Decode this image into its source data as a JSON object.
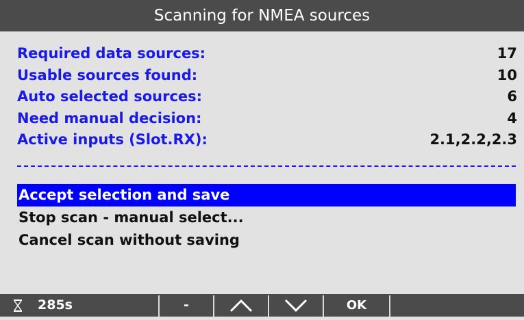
{
  "title": "Scanning for NMEA sources",
  "stats": [
    {
      "label": "Required data sources:",
      "value": "17"
    },
    {
      "label": "Usable sources found:",
      "value": "10"
    },
    {
      "label": "Auto selected sources:",
      "value": "6"
    },
    {
      "label": "Need manual decision:",
      "value": "4"
    },
    {
      "label": "Active inputs (Slot.RX):",
      "value": "2.1,2.2,2.3"
    }
  ],
  "menu": [
    {
      "label": "Accept selection and save",
      "selected": true
    },
    {
      "label": "Stop scan - manual select...",
      "selected": false
    },
    {
      "label": "Cancel scan without saving",
      "selected": false
    }
  ],
  "bottom_bar": {
    "timer_icon": "hourglass-icon",
    "timer": "285s",
    "btn_minus": "-",
    "btn_up_icon": "chevron-up-icon",
    "btn_down_icon": "chevron-down-icon",
    "btn_ok": "OK"
  },
  "colors": {
    "title_bg": "#4b4b4b",
    "label_blue": "#1a1ae6",
    "selection": "#0000ff",
    "background": "#e2e2e2"
  }
}
